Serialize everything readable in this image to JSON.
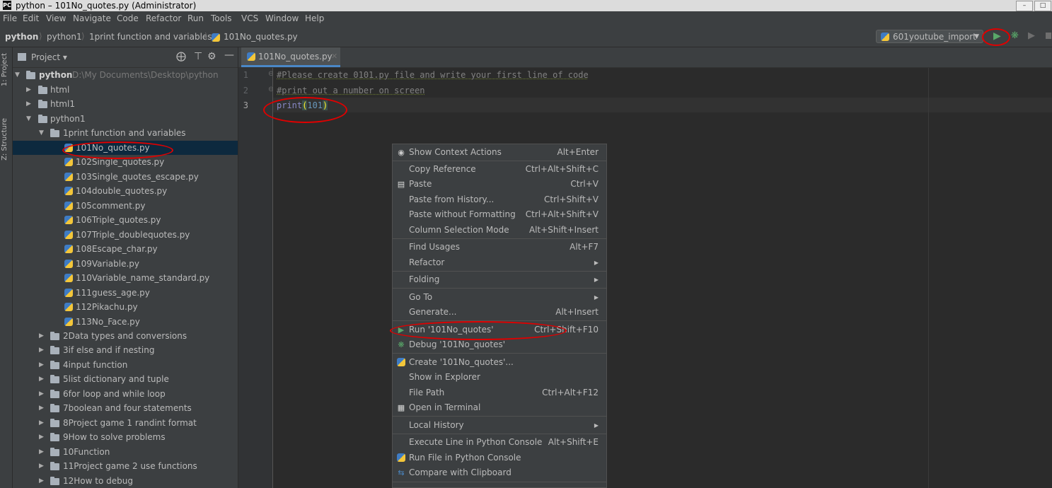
{
  "window": {
    "title": "python – 101No_quotes.py (Administrator)"
  },
  "menu": [
    "File",
    "Edit",
    "View",
    "Navigate",
    "Code",
    "Refactor",
    "Run",
    "Tools",
    "VCS",
    "Window",
    "Help"
  ],
  "breadcrumb": [
    "python",
    "python1",
    "1print function and variables",
    "101No_quotes.py"
  ],
  "toolbar": {
    "run_config": "601youtube_import"
  },
  "sidebar_tabs": {
    "project": "1: Project",
    "structure": "Z: Structure"
  },
  "project_panel": {
    "header": "Project",
    "root_name": "python",
    "root_path": "D:\\My Documents\\Desktop\\python",
    "items": [
      "html",
      "html1",
      "python1",
      "1print function and variables",
      "101No_quotes.py",
      "102Single_quotes.py",
      "103Single_quotes_escape.py",
      "104double_quotes.py",
      "105comment.py",
      "106Triple_quotes.py",
      "107Triple_doublequotes.py",
      "108Escape_char.py",
      "109Variable.py",
      "110Variable_name_standard.py",
      "111guess_age.py",
      "112Pikachu.py",
      "113No_Face.py",
      "2Data types and conversions",
      "3if else and if nesting",
      "4input function",
      "5list dictionary and tuple",
      "6for loop and while loop",
      "7boolean and four statements",
      "8Project game 1 randint format",
      "9How to solve problems",
      "10Function",
      "11Project game 2 use functions",
      "12How to debug"
    ]
  },
  "editor": {
    "tab": "101No_quotes.py",
    "line_numbers": [
      "1",
      "2",
      "3"
    ],
    "lines": [
      "#Please create 0101.py file and write your first line of code",
      "#print out a number on screen"
    ],
    "code_fn": "print",
    "code_open": "(",
    "code_num": "101",
    "code_close": ")"
  },
  "context_menu": [
    {
      "label": "Show Context Actions",
      "shortcut": "Alt+Enter"
    },
    {
      "label": "Copy Reference",
      "shortcut": "Ctrl+Alt+Shift+C"
    },
    {
      "label": "Paste",
      "shortcut": "Ctrl+V"
    },
    {
      "label": "Paste from History...",
      "shortcut": "Ctrl+Shift+V"
    },
    {
      "label": "Paste without Formatting",
      "shortcut": "Ctrl+Alt+Shift+V"
    },
    {
      "label": "Column Selection Mode",
      "shortcut": "Alt+Shift+Insert"
    },
    {
      "label": "Find Usages",
      "shortcut": "Alt+F7"
    },
    {
      "label": "Refactor",
      "shortcut": ""
    },
    {
      "label": "Folding",
      "shortcut": ""
    },
    {
      "label": "Go To",
      "shortcut": ""
    },
    {
      "label": "Generate...",
      "shortcut": "Alt+Insert"
    },
    {
      "label": "Run '101No_quotes'",
      "shortcut": "Ctrl+Shift+F10"
    },
    {
      "label": "Debug '101No_quotes'",
      "shortcut": ""
    },
    {
      "label": "Create '101No_quotes'...",
      "shortcut": ""
    },
    {
      "label": "Show in Explorer",
      "shortcut": ""
    },
    {
      "label": "File Path",
      "shortcut": "Ctrl+Alt+F12"
    },
    {
      "label": "Open in Terminal",
      "shortcut": ""
    },
    {
      "label": "Local History",
      "shortcut": ""
    },
    {
      "label": "Execute Line in Python Console",
      "shortcut": "Alt+Shift+E"
    },
    {
      "label": "Run File in Python Console",
      "shortcut": ""
    },
    {
      "label": "Compare with Clipboard",
      "shortcut": ""
    }
  ],
  "colors": {
    "accent_run": "#59a869",
    "annotation": "#e00000",
    "selection": "#0d293e"
  }
}
